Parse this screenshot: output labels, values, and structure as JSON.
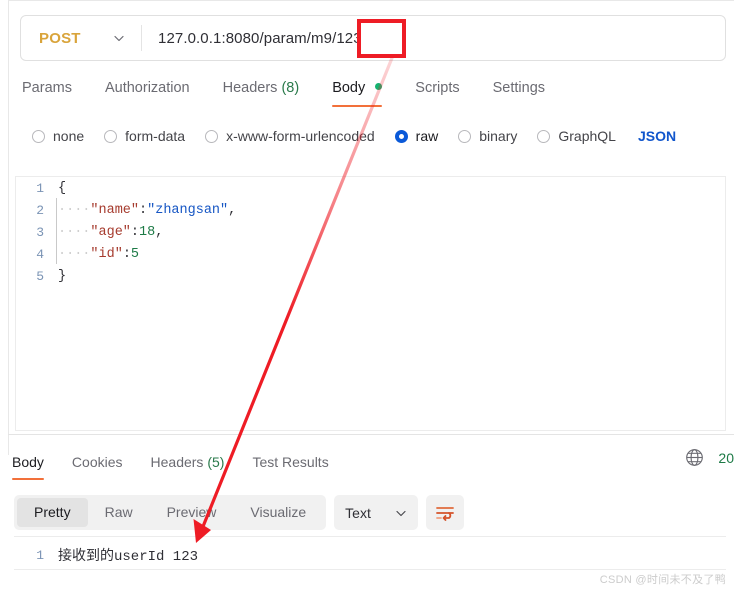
{
  "request": {
    "method": "POST",
    "url": "127.0.0.1:8080/param/m9/123",
    "url_prefix": "127.0.0.1:8080/param/m9/",
    "url_highlight": "123",
    "tabs": [
      {
        "label": "Params",
        "count": "",
        "active": false,
        "dot": false
      },
      {
        "label": "Authorization",
        "count": "",
        "active": false,
        "dot": false
      },
      {
        "label": "Headers",
        "count": "(8)",
        "active": false,
        "dot": false
      },
      {
        "label": "Body",
        "count": "",
        "active": true,
        "dot": true
      },
      {
        "label": "Scripts",
        "count": "",
        "active": false,
        "dot": false
      },
      {
        "label": "Settings",
        "count": "",
        "active": false,
        "dot": false
      }
    ],
    "body_types": [
      {
        "label": "none",
        "selected": false
      },
      {
        "label": "form-data",
        "selected": false
      },
      {
        "label": "x-www-form-urlencoded",
        "selected": false
      },
      {
        "label": "raw",
        "selected": true
      },
      {
        "label": "binary",
        "selected": false
      },
      {
        "label": "GraphQL",
        "selected": false
      }
    ],
    "raw_format": "JSON",
    "body_lines": [
      {
        "n": "1",
        "dots": "",
        "tokens": [
          {
            "t": "{",
            "c": "tk-punc"
          }
        ]
      },
      {
        "n": "2",
        "dots": "····",
        "tokens": [
          {
            "t": "\"name\"",
            "c": "tk-key"
          },
          {
            "t": ":",
            "c": "tk-punc"
          },
          {
            "t": "\"zhangsan\"",
            "c": "tk-str"
          },
          {
            "t": ",",
            "c": "tk-punc"
          }
        ]
      },
      {
        "n": "3",
        "dots": "····",
        "tokens": [
          {
            "t": "\"age\"",
            "c": "tk-key"
          },
          {
            "t": ":",
            "c": "tk-punc"
          },
          {
            "t": "18",
            "c": "tk-num"
          },
          {
            "t": ",",
            "c": "tk-punc"
          }
        ]
      },
      {
        "n": "4",
        "dots": "····",
        "tokens": [
          {
            "t": "\"id\"",
            "c": "tk-key"
          },
          {
            "t": ":",
            "c": "tk-punc"
          },
          {
            "t": "5",
            "c": "tk-num"
          }
        ]
      },
      {
        "n": "5",
        "dots": "",
        "tokens": [
          {
            "t": "}",
            "c": "tk-punc"
          }
        ]
      }
    ]
  },
  "response": {
    "tabs": [
      {
        "label": "Body",
        "count": "",
        "active": true
      },
      {
        "label": "Cookies",
        "count": "",
        "active": false
      },
      {
        "label": "Headers",
        "count": "(5)",
        "active": false
      },
      {
        "label": "Test Results",
        "count": "",
        "active": false
      }
    ],
    "status_code": "20",
    "view_modes": [
      {
        "label": "Pretty",
        "active": true
      },
      {
        "label": "Raw",
        "active": false
      },
      {
        "label": "Preview",
        "active": false
      },
      {
        "label": "Visualize",
        "active": false
      }
    ],
    "format": "Text",
    "body_lines": [
      {
        "n": "1",
        "text": "接收到的userId 123"
      }
    ]
  },
  "annotation": {
    "color": "#ee1c25",
    "highlight_value": "123"
  },
  "watermark": "CSDN @时间未不及了鸭",
  "colors": {
    "accent_orange": "#f2703a",
    "method_amber": "#d9a43b",
    "radio_blue": "#0a59d8",
    "status_green": "#1d7a46",
    "annotation_red": "#ee1c25"
  }
}
